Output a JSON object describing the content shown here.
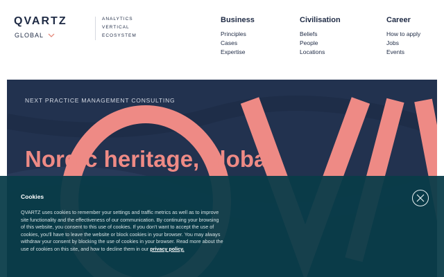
{
  "header": {
    "logo": "QVARTZ",
    "region": "GLOBAL",
    "subnav": [
      "ANALYTICS",
      "VERTICAL",
      "ECOSYSTEM"
    ],
    "menus": [
      {
        "title": "Business",
        "items": [
          "Principles",
          "Cases",
          "Expertise"
        ]
      },
      {
        "title": "Civilisation",
        "items": [
          "Beliefs",
          "People",
          "Locations"
        ]
      },
      {
        "title": "Career",
        "items": [
          "How to apply",
          "Jobs",
          "Events"
        ]
      }
    ]
  },
  "hero": {
    "eyebrow": "NEXT PRACTICE MANAGEMENT CONSULTING",
    "title": "Nordic heritage, global"
  },
  "cookie": {
    "title": "Cookies",
    "text": "QVARTZ uses cookies to remember your settings and traffic metrics as well as to improve site functionality and the effectiveness of our communication. By continuing your browsing of this website, you consent to this use of cookies. If you don't want to accept the use of cookies, you'll have to leave the website or block cookies in your browser. You may always withdraw your consent by blocking the use of cookies in your browser. Read more about the use of cookies on this site, and how to decline them in our",
    "link": "privacy policy."
  },
  "icons": {
    "region_toggle": "chevron-down-icon",
    "close": "close-icon"
  },
  "colors": {
    "navy": "#22324f",
    "salmon": "#ee8a85",
    "banner": "#083c48"
  }
}
